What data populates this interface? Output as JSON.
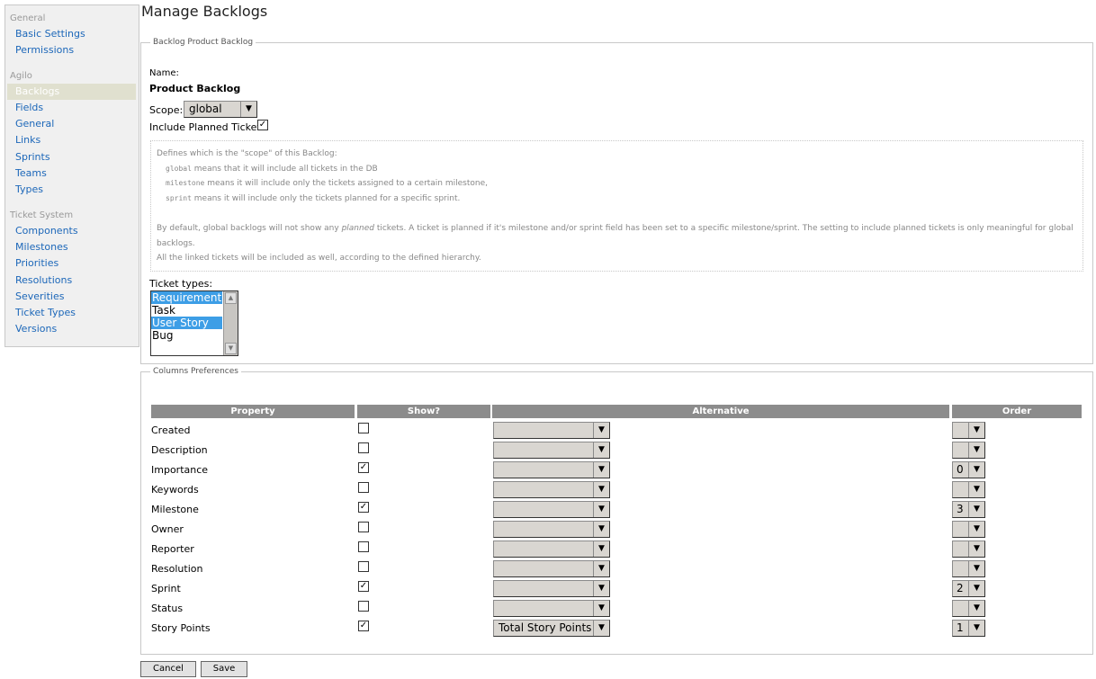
{
  "page": {
    "title": "Manage Backlogs"
  },
  "sidebar": {
    "groups": [
      {
        "title": "General",
        "items": [
          "Basic Settings",
          "Permissions"
        ]
      },
      {
        "title": "Agilo",
        "items": [
          "Backlogs",
          "Fields",
          "General",
          "Links",
          "Sprints",
          "Teams",
          "Types"
        ]
      },
      {
        "title": "Ticket System",
        "items": [
          "Components",
          "Milestones",
          "Priorities",
          "Resolutions",
          "Severities",
          "Ticket Types",
          "Versions"
        ]
      }
    ],
    "active": "Backlogs"
  },
  "backlog": {
    "legend": "Backlog Product Backlog",
    "name_label": "Name:",
    "name_value": "Product Backlog",
    "scope_label": "Scope:",
    "scope_value": "global",
    "include_planned_label": "Include Planned Tickets:",
    "include_planned_checked": true,
    "help": {
      "intro": "Defines which is the \"scope\" of this Backlog:",
      "global_code": "global",
      "global_text": " means that it will include all tickets in the DB",
      "milestone_code": "milestone",
      "milestone_text": " means it will include only the tickets assigned to a certain milestone,",
      "sprint_code": "sprint",
      "sprint_text": " means it will include only the tickets planned for a specific sprint.",
      "planned_pre": "By default, global backlogs will not show any ",
      "planned_em": "planned",
      "planned_post": " tickets. A ticket is planned if it's milestone and/or sprint field has been set to a specific milestone/sprint. The setting to include planned tickets is only meaningful for global backlogs.",
      "linked": "All the linked tickets will be included as well, according to the defined hierarchy."
    },
    "ticket_types_label": "Ticket types:",
    "ticket_types": [
      {
        "label": "Requirement",
        "selected": true
      },
      {
        "label": "Task",
        "selected": false
      },
      {
        "label": "User Story",
        "selected": true
      },
      {
        "label": "Bug",
        "selected": false
      }
    ]
  },
  "columns": {
    "legend": "Columns Preferences",
    "headers": {
      "property": "Property",
      "show": "Show?",
      "alternative": "Alternative",
      "order": "Order"
    },
    "rows": [
      {
        "property": "Created",
        "show": false,
        "alternative": "",
        "order": ""
      },
      {
        "property": "Description",
        "show": false,
        "alternative": "",
        "order": ""
      },
      {
        "property": "Importance",
        "show": true,
        "alternative": "",
        "order": "0"
      },
      {
        "property": "Keywords",
        "show": false,
        "alternative": "",
        "order": ""
      },
      {
        "property": "Milestone",
        "show": true,
        "alternative": "",
        "order": "3"
      },
      {
        "property": "Owner",
        "show": false,
        "alternative": "",
        "order": ""
      },
      {
        "property": "Reporter",
        "show": false,
        "alternative": "",
        "order": ""
      },
      {
        "property": "Resolution",
        "show": false,
        "alternative": "",
        "order": ""
      },
      {
        "property": "Sprint",
        "show": true,
        "alternative": "",
        "order": "2"
      },
      {
        "property": "Status",
        "show": false,
        "alternative": "",
        "order": ""
      },
      {
        "property": "Story Points",
        "show": true,
        "alternative": "Total Story Points",
        "order": "1"
      }
    ]
  },
  "buttons": {
    "cancel": "Cancel",
    "save": "Save"
  },
  "icons": {
    "check": "check-icon",
    "dropdown": "dropdown-arrow-icon"
  },
  "colors": {
    "link": "#1c67b9",
    "header_bg": "#8c8c8c",
    "selected": "#3d9ee6",
    "active_nav": "#e0e0cf"
  }
}
